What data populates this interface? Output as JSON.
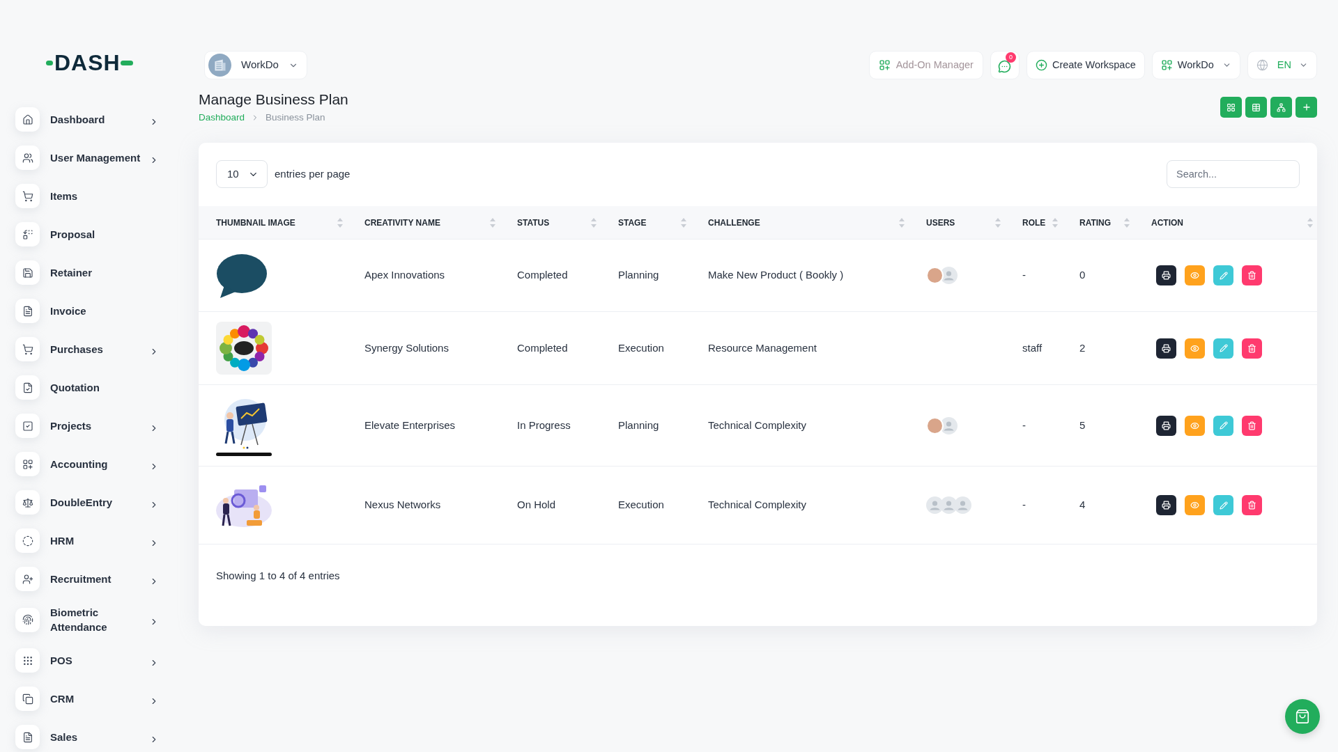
{
  "sidebar": {
    "logo": "DASH",
    "items": [
      {
        "label": "Dashboard",
        "has_submenu": true
      },
      {
        "label": "User Management",
        "has_submenu": true
      },
      {
        "label": "Items",
        "has_submenu": false
      },
      {
        "label": "Proposal",
        "has_submenu": false
      },
      {
        "label": "Retainer",
        "has_submenu": false
      },
      {
        "label": "Invoice",
        "has_submenu": false
      },
      {
        "label": "Purchases",
        "has_submenu": true
      },
      {
        "label": "Quotation",
        "has_submenu": false
      },
      {
        "label": "Projects",
        "has_submenu": true
      },
      {
        "label": "Accounting",
        "has_submenu": true
      },
      {
        "label": "DoubleEntry",
        "has_submenu": true
      },
      {
        "label": "HRM",
        "has_submenu": true
      },
      {
        "label": "Recruitment",
        "has_submenu": true
      },
      {
        "label": "Biometric Attendance",
        "has_submenu": true
      },
      {
        "label": "POS",
        "has_submenu": true
      },
      {
        "label": "CRM",
        "has_submenu": true
      },
      {
        "label": "Sales",
        "has_submenu": true
      }
    ]
  },
  "topbar": {
    "workspace": "WorkDo",
    "add_on_manager": {
      "label": "Add-On Manager",
      "disabled": true
    },
    "messages": {
      "badge": "0"
    },
    "create_workspace": "Create Workspace",
    "workspace_menu": "WorkDo",
    "language": "EN"
  },
  "page": {
    "title": "Manage Business Plan",
    "breadcrumb": [
      {
        "label": "Dashboard",
        "link": true
      },
      {
        "label": "Business Plan",
        "link": false
      }
    ]
  },
  "table": {
    "page_size": "10",
    "page_size_label": "entries per page",
    "search": {
      "placeholder": "Search..."
    },
    "columns": [
      "THUMBNAIL IMAGE",
      "CREATIVITY NAME",
      "STATUS",
      "STAGE",
      "CHALLENGE",
      "USERS",
      "ROLE",
      "RATING",
      "ACTION"
    ],
    "rows": [
      {
        "name": "Apex Innovations",
        "status": "Completed",
        "stage": "Planning",
        "challenge": "Make New Product ( Bookly )",
        "users": [
          {
            "kind": "photo"
          },
          {
            "kind": "default"
          }
        ],
        "role": "-",
        "rating": "0"
      },
      {
        "name": "Synergy Solutions",
        "status": "Completed",
        "stage": "Execution",
        "challenge": "Resource Management",
        "role": "staff",
        "rating": "2"
      },
      {
        "name": "Elevate Enterprises",
        "status": "In Progress",
        "stage": "Planning",
        "challenge": "Technical Complexity",
        "users": [
          {
            "kind": "photo"
          },
          {
            "kind": "default"
          }
        ],
        "role": "-",
        "rating": "5"
      },
      {
        "name": "Nexus Networks",
        "status": "On Hold",
        "stage": "Execution",
        "challenge": "Technical Complexity",
        "users": [
          {
            "kind": "default"
          },
          {
            "kind": "default"
          },
          {
            "kind": "default"
          }
        ],
        "role": "-",
        "rating": "4"
      }
    ],
    "footer": "Showing 1 to 4 of 4 entries"
  }
}
